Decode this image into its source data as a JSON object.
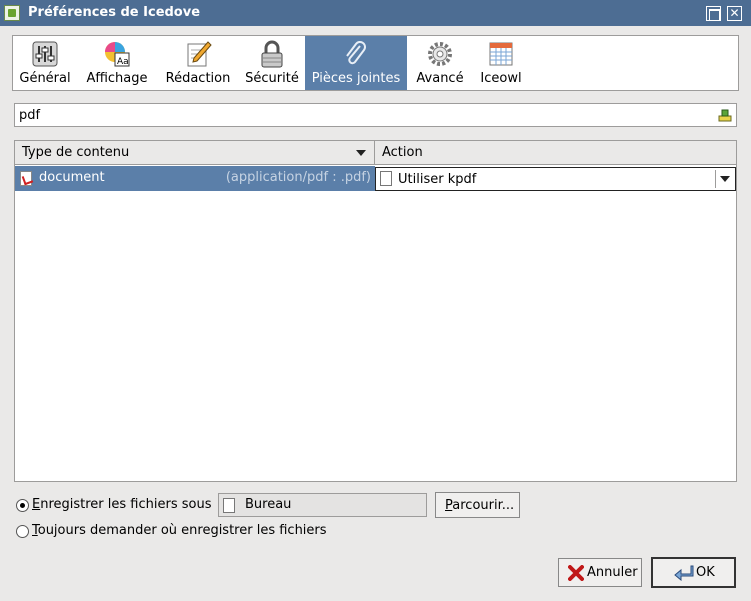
{
  "window": {
    "title": "Préférences de Icedove"
  },
  "tabs": [
    {
      "label": "Général",
      "icon": "sliders-icon"
    },
    {
      "label": "Affichage",
      "icon": "font-color-icon"
    },
    {
      "label": "Rédaction",
      "icon": "pencil-icon"
    },
    {
      "label": "Sécurité",
      "icon": "padlock-icon"
    },
    {
      "label": "Pièces jointes",
      "icon": "paperclip-icon",
      "selected": true
    },
    {
      "label": "Avancé",
      "icon": "gear-icon"
    },
    {
      "label": "Iceowl",
      "icon": "calendar-icon"
    }
  ],
  "search": {
    "value": "pdf"
  },
  "table": {
    "columns": [
      "Type de contenu",
      "Action"
    ],
    "rows": [
      {
        "name": "document",
        "mime": "(application/pdf : .pdf)",
        "action": "Utiliser kpdf"
      }
    ]
  },
  "save": {
    "option1_label": "Enregistrer les fichiers sous",
    "option1_mnemonic": "E",
    "option1_rest": "nregistrer les fichiers sous",
    "option2_mnemonic": "T",
    "option2_rest": "oujours demander où enregistrer les fichiers",
    "folder": "Bureau",
    "browse_mnemonic": "P",
    "browse_rest": "arcourir..."
  },
  "buttons": {
    "cancel": "Annuler",
    "ok": "OK"
  },
  "colors": {
    "titlebar": "#4d6d93",
    "selection": "#5b7fa9",
    "window_bg": "#eae9e8"
  }
}
